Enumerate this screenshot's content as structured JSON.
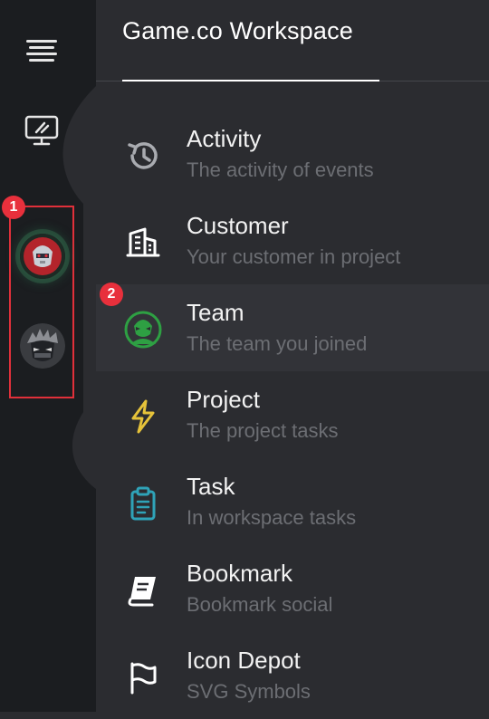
{
  "header": {
    "title": "Game.co Workspace"
  },
  "rail": {
    "menu_icon": "hamburger-icon",
    "desktop_icon": "monitor-icon",
    "avatars": [
      {
        "name": "red-knight-avatar",
        "active": true
      },
      {
        "name": "dark-ninja-avatar",
        "active": false
      }
    ]
  },
  "annotations": {
    "badge1": "1",
    "badge2": "2",
    "badge_color": "#e8303c"
  },
  "menu": {
    "items": [
      {
        "label": "Activity",
        "sub": "The activity of events",
        "icon": "history-icon",
        "color": "#a9abb0"
      },
      {
        "label": "Customer",
        "sub": "Your customer in project",
        "icon": "building-icon",
        "color": "#ffffff"
      },
      {
        "label": "Team",
        "sub": "The team you joined",
        "icon": "alien-icon",
        "color": "#2ea043",
        "active": true
      },
      {
        "label": "Project",
        "sub": "The project tasks",
        "icon": "lightning-icon",
        "color": "#e5c23a"
      },
      {
        "label": "Task",
        "sub": "In workspace tasks",
        "icon": "clipboard-icon",
        "color": "#2fa3b8"
      },
      {
        "label": "Bookmark",
        "sub": "Bookmark social",
        "icon": "book-icon",
        "color": "#ffffff"
      },
      {
        "label": "Icon Depot",
        "sub": "SVG Symbols",
        "icon": "flag-icon",
        "color": "#ffffff"
      }
    ]
  }
}
